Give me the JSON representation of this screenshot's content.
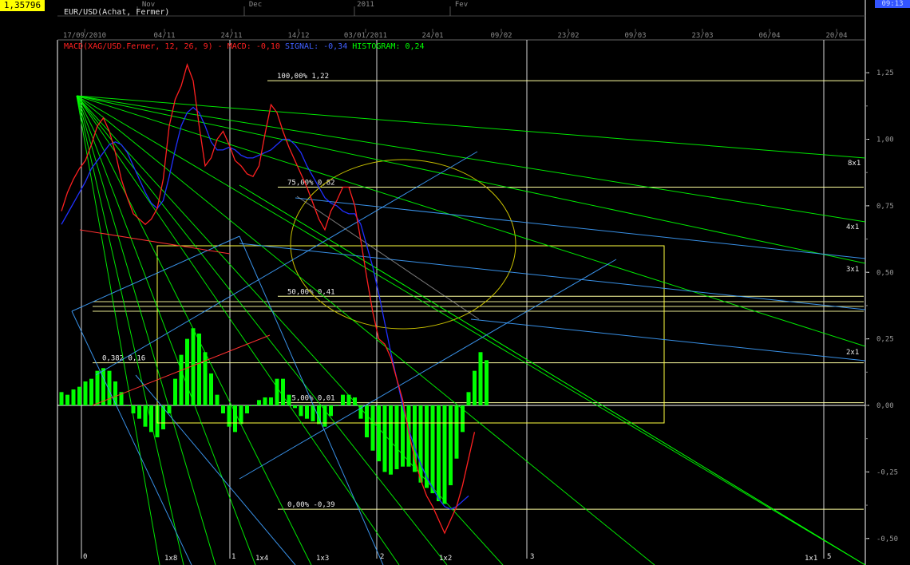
{
  "window": {
    "price_box": "1,35796",
    "corner_box": "09:13",
    "title": "EUR/USD(Achat, Fermer)"
  },
  "months": [
    "Nov",
    "Dec",
    "2011",
    "Fev"
  ],
  "dates": [
    "17/09/2010",
    "04/11",
    "24/11",
    "14/12",
    "03/01/2011",
    "24/01",
    "09/02",
    "23/02",
    "09/03",
    "23/03",
    "06/04",
    "20/04"
  ],
  "legend": {
    "macd": "MACD(XAG/USD.Fermer, 12, 26, 9) - MACD: -0,10",
    "signal": "SIGNAL: -0,34",
    "histogram": "HISTOGRAM: 0,24"
  },
  "gann_labels": [
    "8x1",
    "4x1",
    "3x1",
    "2x1",
    "1x1",
    "1x2",
    "1x3",
    "1x4",
    "1x8"
  ],
  "bottom_marks": [
    "0",
    "1",
    "2",
    "3",
    "5"
  ],
  "colors": {
    "macd": "#ff2020",
    "signal": "#2030ff",
    "histogram": "#00ff00",
    "fib": "#ffffa0",
    "gann": "#00ff00",
    "channel": "#3fa0ff",
    "ellipse": "#c8c000",
    "grid": "#ffffff"
  },
  "chart_data": {
    "type": "line",
    "ylim": [
      -0.52,
      1.38
    ],
    "yticks": [
      1.25,
      1.0,
      0.75,
      0.5,
      0.25,
      0.0,
      -0.25,
      -0.5
    ],
    "ytick_labels": [
      "1,25",
      "1,00",
      "0,75",
      "0,50",
      "0,25",
      "0,00",
      "-0,25",
      "-0,50"
    ],
    "x_count": 70,
    "macd": [
      0.73,
      0.8,
      0.85,
      0.89,
      0.92,
      0.98,
      1.05,
      1.08,
      1.03,
      0.95,
      0.85,
      0.78,
      0.72,
      0.7,
      0.68,
      0.7,
      0.74,
      0.85,
      1.05,
      1.15,
      1.2,
      1.28,
      1.22,
      1.05,
      0.9,
      0.93,
      1.0,
      1.03,
      0.98,
      0.92,
      0.9,
      0.87,
      0.86,
      0.9,
      1.02,
      1.13,
      1.1,
      1.03,
      0.97,
      0.92,
      0.87,
      0.82,
      0.76,
      0.7,
      0.66,
      0.73,
      0.77,
      0.82,
      0.82,
      0.75,
      0.62,
      0.48,
      0.35,
      0.25,
      0.23,
      0.18,
      0.1,
      0.02,
      -0.1,
      -0.2,
      -0.28,
      -0.34,
      -0.38,
      -0.43,
      -0.48,
      -0.43,
      -0.38,
      -0.3,
      -0.2,
      -0.1
    ],
    "signal": [
      0.68,
      0.72,
      0.76,
      0.8,
      0.84,
      0.89,
      0.92,
      0.95,
      0.98,
      0.99,
      0.98,
      0.95,
      0.9,
      0.85,
      0.8,
      0.76,
      0.74,
      0.77,
      0.86,
      0.96,
      1.05,
      1.1,
      1.12,
      1.1,
      1.05,
      0.99,
      0.96,
      0.96,
      0.97,
      0.96,
      0.94,
      0.93,
      0.93,
      0.94,
      0.95,
      0.96,
      0.98,
      1.0,
      1.0,
      0.98,
      0.95,
      0.9,
      0.86,
      0.82,
      0.78,
      0.76,
      0.75,
      0.73,
      0.72,
      0.72,
      0.68,
      0.6,
      0.52,
      0.42,
      0.31,
      0.2,
      0.1,
      0.0,
      -0.09,
      -0.16,
      -0.22,
      -0.27,
      -0.31,
      -0.35,
      -0.38,
      -0.39,
      -0.38,
      -0.36,
      -0.34
    ],
    "histogram": [
      0.05,
      0.04,
      0.06,
      0.07,
      0.09,
      0.1,
      0.13,
      0.14,
      0.13,
      0.09,
      0.05,
      0.0,
      -0.03,
      -0.05,
      -0.08,
      -0.1,
      -0.12,
      -0.09,
      -0.03,
      0.1,
      0.19,
      0.25,
      0.29,
      0.27,
      0.2,
      0.12,
      0.04,
      -0.03,
      -0.08,
      -0.1,
      -0.07,
      -0.03,
      0.0,
      0.02,
      0.03,
      0.03,
      0.1,
      0.1,
      0.04,
      -0.01,
      -0.04,
      -0.05,
      -0.06,
      -0.07,
      -0.08,
      -0.04,
      0.0,
      0.04,
      0.04,
      0.03,
      -0.05,
      -0.12,
      -0.17,
      -0.21,
      -0.25,
      -0.26,
      -0.24,
      -0.23,
      -0.23,
      -0.25,
      -0.29,
      -0.31,
      -0.33,
      -0.36,
      -0.37,
      -0.3,
      -0.2,
      -0.1,
      0.05,
      0.13,
      0.2,
      0.17
    ],
    "fib_levels": [
      {
        "label": "100,00% 1,22",
        "value": 1.22
      },
      {
        "label": "75,00% 0,82",
        "value": 0.82
      },
      {
        "label": "50,00% 0,41",
        "value": 0.41
      },
      {
        "label": "0,382 0,16",
        "value": 0.16
      },
      {
        "label": "25,00% 0,01",
        "value": 0.01
      },
      {
        "label": "0,00% -0,39",
        "value": -0.39
      }
    ]
  }
}
